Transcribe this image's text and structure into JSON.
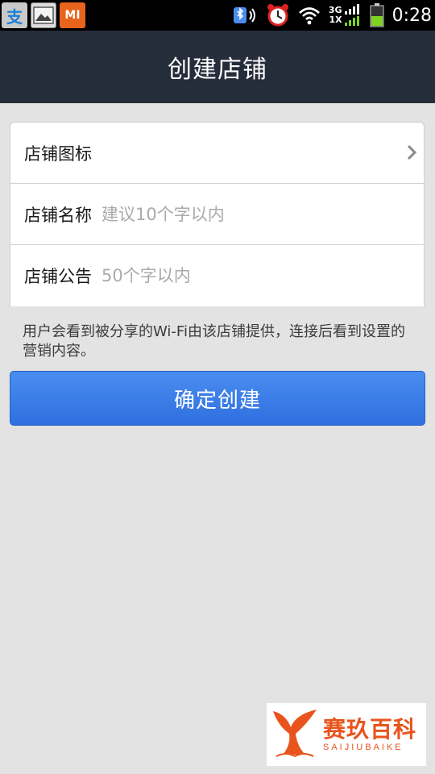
{
  "status_bar": {
    "left_icons": [
      "alipay-icon",
      "gallery-icon",
      "mi-icon"
    ],
    "alipay_glyph": "支",
    "mi_glyph": "MI",
    "right_icons": [
      "bluetooth-audio-icon",
      "alarm-icon",
      "wifi-icon",
      "signal-icon",
      "battery-icon"
    ],
    "net_top": "3G",
    "net_bottom": "1X",
    "time": "0:28"
  },
  "header": {
    "title": "创建店铺"
  },
  "form": {
    "rows": [
      {
        "label": "店铺图标",
        "value": "",
        "placeholder": ""
      },
      {
        "label": "店铺名称",
        "value": "",
        "placeholder": "建议10个字以内"
      },
      {
        "label": "店铺公告",
        "value": "",
        "placeholder": "50个字以内"
      }
    ]
  },
  "hint": "用户会看到被分享的Wi-Fi由该店铺提供，连接后看到设置的营销内容。",
  "confirm_button": {
    "label": "确定创建",
    "color": "#3a7de8"
  },
  "watermark": {
    "cn": "赛玖百科",
    "en": "SAIJIUBAIKE",
    "color": "#e8541c"
  },
  "colors": {
    "title_bar": "#252c3a",
    "background": "#e3e3e3"
  }
}
